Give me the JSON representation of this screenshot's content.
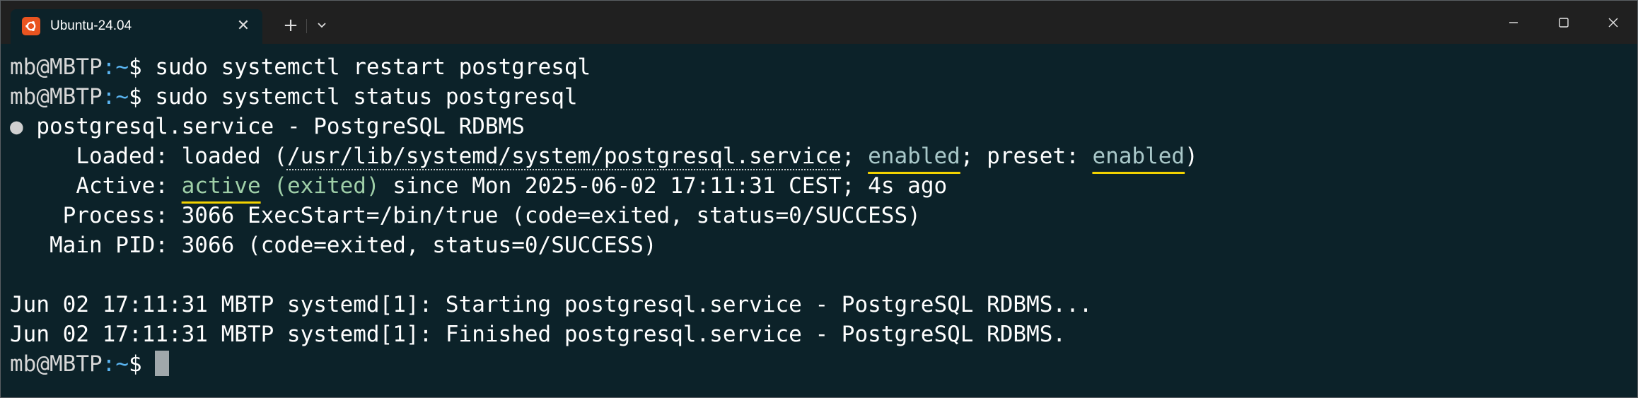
{
  "window": {
    "tab_title": "Ubuntu-24.04",
    "tab_close": "✕",
    "new_tab": "+",
    "dropdown_icon": "chevron-down-icon",
    "minimize_icon": "minimize-icon",
    "maximize_icon": "maximize-icon",
    "close_icon": "close-icon",
    "accent_color": "#e95420"
  },
  "prompt": {
    "user_host": "mb@MBTP",
    "path": ":~",
    "symbol": "$"
  },
  "terminal": {
    "cmd1": " sudo systemctl restart postgresql",
    "cmd2": " sudo systemctl status postgresql",
    "service_dot": "●",
    "service_line": " postgresql.service - PostgreSQL RDBMS",
    "loaded_label": "     Loaded: loaded (",
    "loaded_path": "/usr/lib/systemd/system/postgresql.service",
    "loaded_sep": "; ",
    "loaded_enabled": "enabled",
    "preset_label": "; preset: ",
    "preset_enabled": "enabled",
    "loaded_close": ")",
    "active_label": "     Active: ",
    "active_state": "active",
    "active_sub": " (exited)",
    "active_since": " since Mon 2025-06-02 17:11:31 CEST; 4s ago",
    "process_line": "    Process: 3066 ExecStart=/bin/true (code=exited, status=0/SUCCESS)",
    "mainpid_line": "   Main PID: 3066 (code=exited, status=0/SUCCESS)",
    "log1": "Jun 02 17:11:31 MBTP systemd[1]: Starting postgresql.service - PostgreSQL RDBMS...",
    "log2": "Jun 02 17:11:31 MBTP systemd[1]: Finished postgresql.service - PostgreSQL RDBMS.",
    "final_cmd": " "
  }
}
